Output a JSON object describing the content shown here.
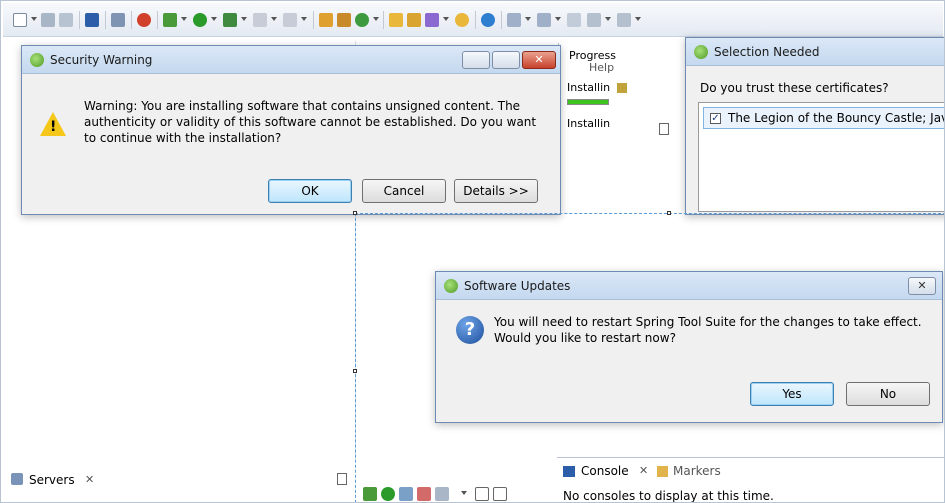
{
  "security_warning": {
    "title": "Security Warning",
    "message": "Warning: You are installing software that contains unsigned content. The authenticity or validity of this software cannot be established. Do you want to continue with the installation?",
    "buttons": {
      "ok": "OK",
      "cancel": "Cancel",
      "details": "Details >>"
    }
  },
  "progress_panel": {
    "tab": "Progress",
    "menu_fragment": "Help",
    "item1": "Installin",
    "item2": "Installin"
  },
  "selection_needed": {
    "title": "Selection Needed",
    "prompt": "Do you trust these certificates?",
    "certificate": "The Legion of the Bouncy Castle; Java Sof",
    "certificate_checked": true
  },
  "software_updates": {
    "title": "Software Updates",
    "message": "You will need to restart Spring Tool Suite for the changes to take effect. Would you like to restart now?",
    "buttons": {
      "yes": "Yes",
      "no": "No"
    }
  },
  "servers_view": {
    "tab": "Servers"
  },
  "console_view": {
    "console_tab": "Console",
    "markers_tab": "Markers",
    "message": "No consoles to display at this time."
  },
  "colors": {
    "accent": "#3c7fb1",
    "progress": "#3ec41e",
    "warning": "#f5c71a"
  }
}
